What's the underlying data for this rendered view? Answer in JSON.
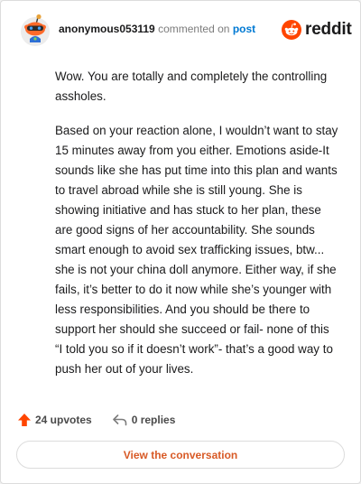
{
  "header": {
    "username": "anonymous053119",
    "action": "commented on",
    "post_link": "post",
    "brand": "reddit"
  },
  "comment": {
    "paragraphs": [
      "Wow. You are totally and completely the controlling assholes.",
      "Based on your reaction alone, I wouldn’t want to stay 15 minutes away from you either. Emotions aside-It sounds like she has put time into this plan and wants to travel abroad while she is still young. She is showing initiative and has stuck to her plan, these are good signs of her accountability. She sounds smart enough to avoid sex trafficking issues, btw... she is not your china doll anymore. Either way, if she fails, it’s better to do it now while she’s younger with less responsibilities. And you should be there to support her should she succeed or fail- none of this “I told you so if it doesn’t work”- that’s a good way to push her out of your lives."
    ]
  },
  "footer": {
    "upvotes": "24 upvotes",
    "replies": "0 replies",
    "view_button": "View the conversation"
  },
  "colors": {
    "brand_orange": "#ff4500",
    "upvote_orange": "#ff4500",
    "link_blue": "#0079d3",
    "button_text": "#d85a26"
  },
  "icons": {
    "avatar": "snoo-avatar-icon",
    "brand": "reddit-logo-icon",
    "upvote": "upvote-arrow-icon",
    "reply": "reply-arrow-icon"
  }
}
